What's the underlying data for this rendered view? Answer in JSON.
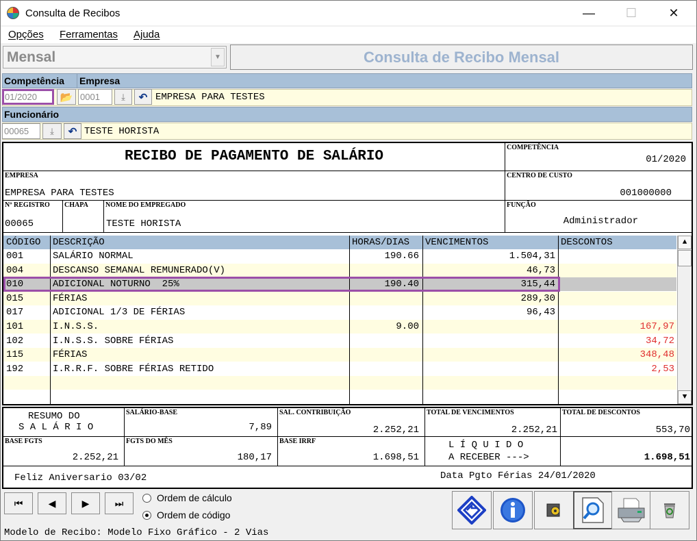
{
  "window": {
    "title": "Consulta de Recibos",
    "minimize": "—",
    "maximize": "☐",
    "close": "✕"
  },
  "menu": [
    "Opções",
    "Ferramentas",
    "Ajuda"
  ],
  "mode": {
    "selected": "Mensal"
  },
  "screen_title": "Consulta de Recibo Mensal",
  "filters": {
    "competencia_label": "Competência",
    "empresa_label": "Empresa",
    "competencia_value": "01/2020",
    "empresa_code": "0001",
    "empresa_name": "EMPRESA PARA TESTES",
    "funcionario_label": "Funcionário",
    "funcionario_code": "00065",
    "funcionario_name": "TESTE HORISTA"
  },
  "receipt": {
    "title": "RECIBO DE PAGAMENTO DE SALÁRIO",
    "competencia_cap": "COMPETÊNCIA",
    "competencia": "01/2020",
    "empresa_cap": "EMPRESA",
    "empresa": "EMPRESA PARA TESTES",
    "centro_cap": "CENTRO DE CUSTO",
    "centro": "001000000",
    "registro_cap": "Nº REGISTRO",
    "registro": "00065",
    "chapa_cap": "CHAPA",
    "chapa": "",
    "nome_cap": "NOME DO EMPREGADO",
    "nome": "TESTE HORISTA",
    "funcao_cap": "FUNÇÃO",
    "funcao": "Administrador"
  },
  "grid": {
    "headers": {
      "codigo": "CÓDIGO",
      "descricao": "DESCRIÇÃO",
      "horas": "HORAS/DIAS",
      "vencimentos": "VENCIMENTOS",
      "descontos": "DESCONTOS"
    },
    "rows": [
      {
        "codigo": "001",
        "descricao": "SALÁRIO NORMAL",
        "horas": "190.66",
        "vencimentos": "1.504,31",
        "descontos": ""
      },
      {
        "codigo": "004",
        "descricao": "DESCANSO SEMANAL REMUNERADO(V)",
        "horas": "",
        "vencimentos": "46,73",
        "descontos": ""
      },
      {
        "codigo": "010",
        "descricao": "ADICIONAL NOTURNO  25%",
        "horas": "190.40",
        "vencimentos": "315,44",
        "descontos": ""
      },
      {
        "codigo": "015",
        "descricao": "FÉRIAS",
        "horas": "",
        "vencimentos": "289,30",
        "descontos": ""
      },
      {
        "codigo": "017",
        "descricao": "ADICIONAL 1/3 DE FÉRIAS",
        "horas": "",
        "vencimentos": "96,43",
        "descontos": ""
      },
      {
        "codigo": "101",
        "descricao": "I.N.S.S.",
        "horas": "9.00",
        "vencimentos": "",
        "descontos": "167,97"
      },
      {
        "codigo": "102",
        "descricao": "I.N.S.S. SOBRE FÉRIAS",
        "horas": "",
        "vencimentos": "",
        "descontos": "34,72"
      },
      {
        "codigo": "115",
        "descricao": "FÉRIAS",
        "horas": "",
        "vencimentos": "",
        "descontos": "348,48"
      },
      {
        "codigo": "192",
        "descricao": "I.R.R.F. SOBRE FÉRIAS RETIDO",
        "horas": "",
        "vencimentos": "",
        "descontos": "2,53"
      },
      {
        "codigo": "",
        "descricao": "",
        "horas": "",
        "vencimentos": "",
        "descontos": ""
      }
    ],
    "selected_row": 2
  },
  "summary": {
    "resumo_line1": "RESUMO DO",
    "resumo_line2": "S A L Á R I O",
    "salario_base_cap": "SALÁRIO-BASE",
    "salario_base": "7,89",
    "sal_contribuicao_cap": "SAL. CONTRIBUIÇÃO",
    "sal_contribuicao": "2.252,21",
    "total_venc_cap": "TOTAL DE VENCIMENTOS",
    "total_venc": "2.252,21",
    "total_desc_cap": "TOTAL DE DESCONTOS",
    "total_desc": "553,70",
    "base_fgts_cap": "BASE FGTS",
    "base_fgts": "2.252,21",
    "fgts_mes_cap": "FGTS DO MÊS",
    "fgts_mes": "180,17",
    "base_irrf_cap": "BASE IRRF",
    "base_irrf": "1.698,51",
    "liquido_line1": "L Í Q U I D O",
    "liquido_line2": "A RECEBER --->",
    "liquido": "1.698,51",
    "aniversario": "Feliz Aniversario 03/02",
    "data_pgto": "Data Pgto Férias 24/01/2020"
  },
  "nav": {
    "first": "⏮",
    "prev": "◀",
    "next": "▶",
    "last": "⏭"
  },
  "order": {
    "calculo": "Ordem de cálculo",
    "codigo": "Ordem de código",
    "selected": "codigo"
  },
  "status": "Modelo de Recibo: Modelo Fixo Gráfico - 2 Vias",
  "colors": {
    "header_bar": "#a8c0d8",
    "row_yellow": "#fffde1",
    "selected_row": "#c8c8c8",
    "highlight_border": "#9b4fa8",
    "negative": "#e03030",
    "screen_title": "#9db3cf"
  }
}
